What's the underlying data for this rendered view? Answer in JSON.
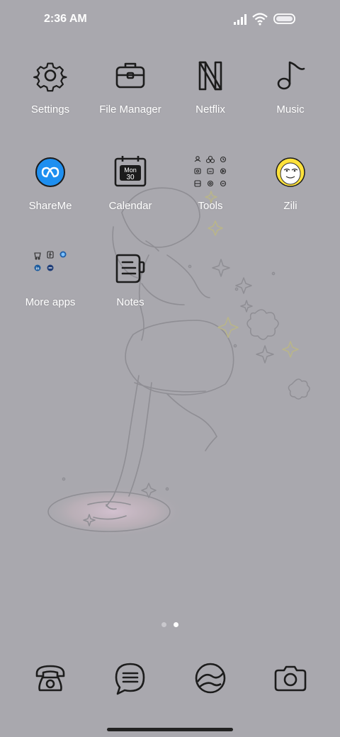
{
  "status_bar": {
    "time": "2:36 AM",
    "icons": [
      "signal-icon",
      "wifi-icon",
      "battery-icon"
    ]
  },
  "apps": [
    {
      "label": "Settings",
      "icon": "gear-icon"
    },
    {
      "label": "File Manager",
      "icon": "briefcase-icon"
    },
    {
      "label": "Netflix",
      "icon": "netflix-n-icon"
    },
    {
      "label": "Music",
      "icon": "music-note-icon"
    },
    {
      "label": "ShareMe",
      "icon": "shareme-icon"
    },
    {
      "label": "Calendar",
      "icon": "calendar-icon",
      "calendar_month": "Mon",
      "calendar_day": "30"
    },
    {
      "label": "Tools",
      "icon": "tools-folder-icon"
    },
    {
      "label": "Zili",
      "icon": "zili-icon"
    },
    {
      "label": "More apps",
      "icon": "more-apps-folder-icon"
    },
    {
      "label": "Notes",
      "icon": "notes-icon"
    }
  ],
  "page_indicator": {
    "pages": 2,
    "current": 2
  },
  "dock": [
    {
      "name": "phone",
      "icon": "phone-icon"
    },
    {
      "name": "messages",
      "icon": "message-icon"
    },
    {
      "name": "browser",
      "icon": "browser-icon"
    },
    {
      "name": "camera",
      "icon": "camera-icon"
    }
  ],
  "colors": {
    "background": "#a9a8ae",
    "icon_stroke": "#1c1c1c",
    "shareme_blue": "#1e8ff0",
    "zili_yellow": "#ffe23b"
  }
}
